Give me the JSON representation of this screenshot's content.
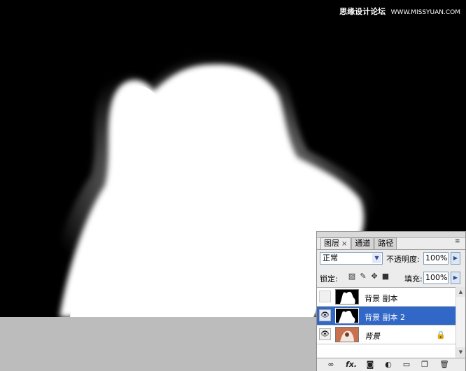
{
  "watermark": {
    "cn": "思缘设计论坛",
    "url": "WWW.MISSYUAN.COM"
  },
  "layers_panel": {
    "tabs": [
      {
        "label": "图层",
        "close": "×"
      },
      {
        "label": "通道"
      },
      {
        "label": "路径"
      }
    ],
    "menu_icon": "≡",
    "blend_mode": "正常",
    "opacity_label": "不透明度:",
    "opacity_value": "100%",
    "lock_label": "锁定:",
    "lock_icons": [
      "transparency-lock-icon",
      "brush-lock-icon",
      "move-lock-icon",
      "all-lock-icon"
    ],
    "fill_label": "填充:",
    "fill_value": "100%",
    "layers": [
      {
        "name": "背景 副本",
        "visible": false,
        "selected": false,
        "italic": false
      },
      {
        "name": "背景 副本 2",
        "visible": true,
        "selected": true,
        "italic": false
      },
      {
        "name": "背景",
        "visible": true,
        "selected": false,
        "italic": true,
        "locked": true
      }
    ],
    "bottom_icons": [
      "link-icon",
      "fx-icon",
      "mask-icon",
      "adjustment-icon",
      "folder-icon",
      "new-layer-icon",
      "trash-icon"
    ],
    "fx_label": "fx."
  }
}
